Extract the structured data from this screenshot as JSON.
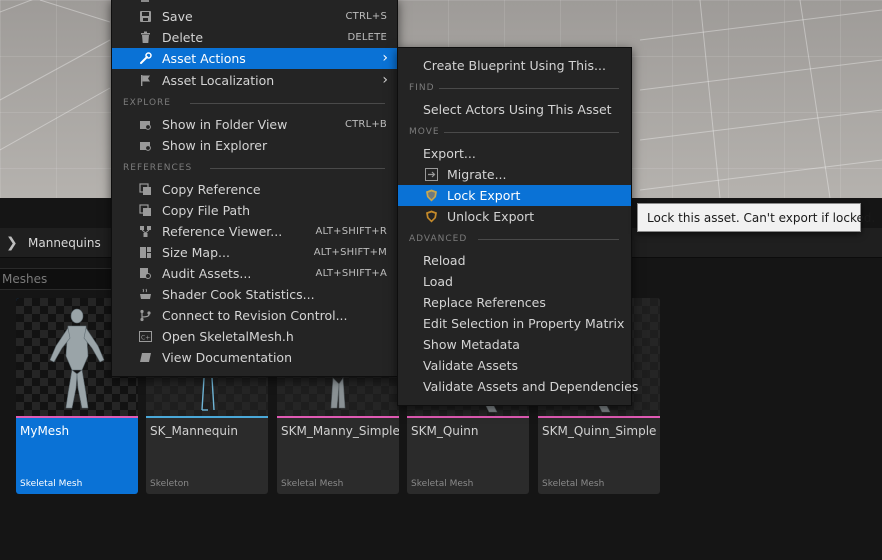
{
  "main_menu": {
    "items": [
      {
        "label": "Save",
        "shortcut": "CTRL+S",
        "icon": "save-icon"
      },
      {
        "label": "Delete",
        "shortcut": "DELETE",
        "icon": "trash-icon"
      },
      {
        "label": "Asset Actions",
        "icon": "wrench-icon",
        "submenu": true
      },
      {
        "label": "Asset Localization",
        "icon": "flag-icon",
        "submenu": true
      }
    ],
    "explore_header": "EXPLORE",
    "explore_items": [
      {
        "label": "Show in Folder View",
        "shortcut": "CTRL+B"
      },
      {
        "label": "Show in Explorer"
      }
    ],
    "references_header": "REFERENCES",
    "references_items": [
      {
        "label": "Copy Reference"
      },
      {
        "label": "Copy File Path"
      },
      {
        "label": "Reference Viewer...",
        "shortcut": "ALT+SHIFT+R"
      },
      {
        "label": "Size Map...",
        "shortcut": "ALT+SHIFT+M"
      },
      {
        "label": "Audit Assets...",
        "shortcut": "ALT+SHIFT+A"
      },
      {
        "label": "Shader Cook Statistics..."
      },
      {
        "label": "Connect to Revision Control..."
      },
      {
        "label": "Open SkeletalMesh.h"
      },
      {
        "label": "View Documentation"
      }
    ]
  },
  "sub_menu": {
    "create_blueprint": "Create Blueprint Using This...",
    "find_header": "FIND",
    "select_actors": "Select Actors Using This Asset",
    "move_header": "MOVE",
    "export": "Export...",
    "migrate": "Migrate...",
    "lock_export": "Lock Export",
    "unlock_export": "Unlock Export",
    "advanced_header": "ADVANCED",
    "advanced_items": [
      "Reload",
      "Load",
      "Replace References",
      "Edit Selection in Property Matrix",
      "Show Metadata",
      "Validate Assets",
      "Validate Assets and Dependencies"
    ]
  },
  "tooltip": "Lock this asset. Can't export if locked.",
  "browser": {
    "breadcrumb": "Mannequins",
    "filter_text": "Meshes",
    "assets": [
      {
        "name": "MyMesh",
        "type": "Skeletal Mesh",
        "accent": "#e05ab4",
        "selected": true
      },
      {
        "name": "SK_Mannequin",
        "type": "Skeleton",
        "accent": "#4aa8d8"
      },
      {
        "name": "SKM_Manny_Simple",
        "type": "Skeletal Mesh",
        "accent": "#e05ab4"
      },
      {
        "name": "SKM_Quinn",
        "type": "Skeletal Mesh",
        "accent": "#e05ab4"
      },
      {
        "name": "SKM_Quinn_Simple",
        "type": "Skeletal Mesh",
        "accent": "#e05ab4"
      }
    ]
  },
  "colors": {
    "highlight": "#0a72d6",
    "menu_bg": "#242424",
    "skeletal_mesh_accent": "#e05ab4",
    "skeleton_accent": "#4aa8d8"
  }
}
